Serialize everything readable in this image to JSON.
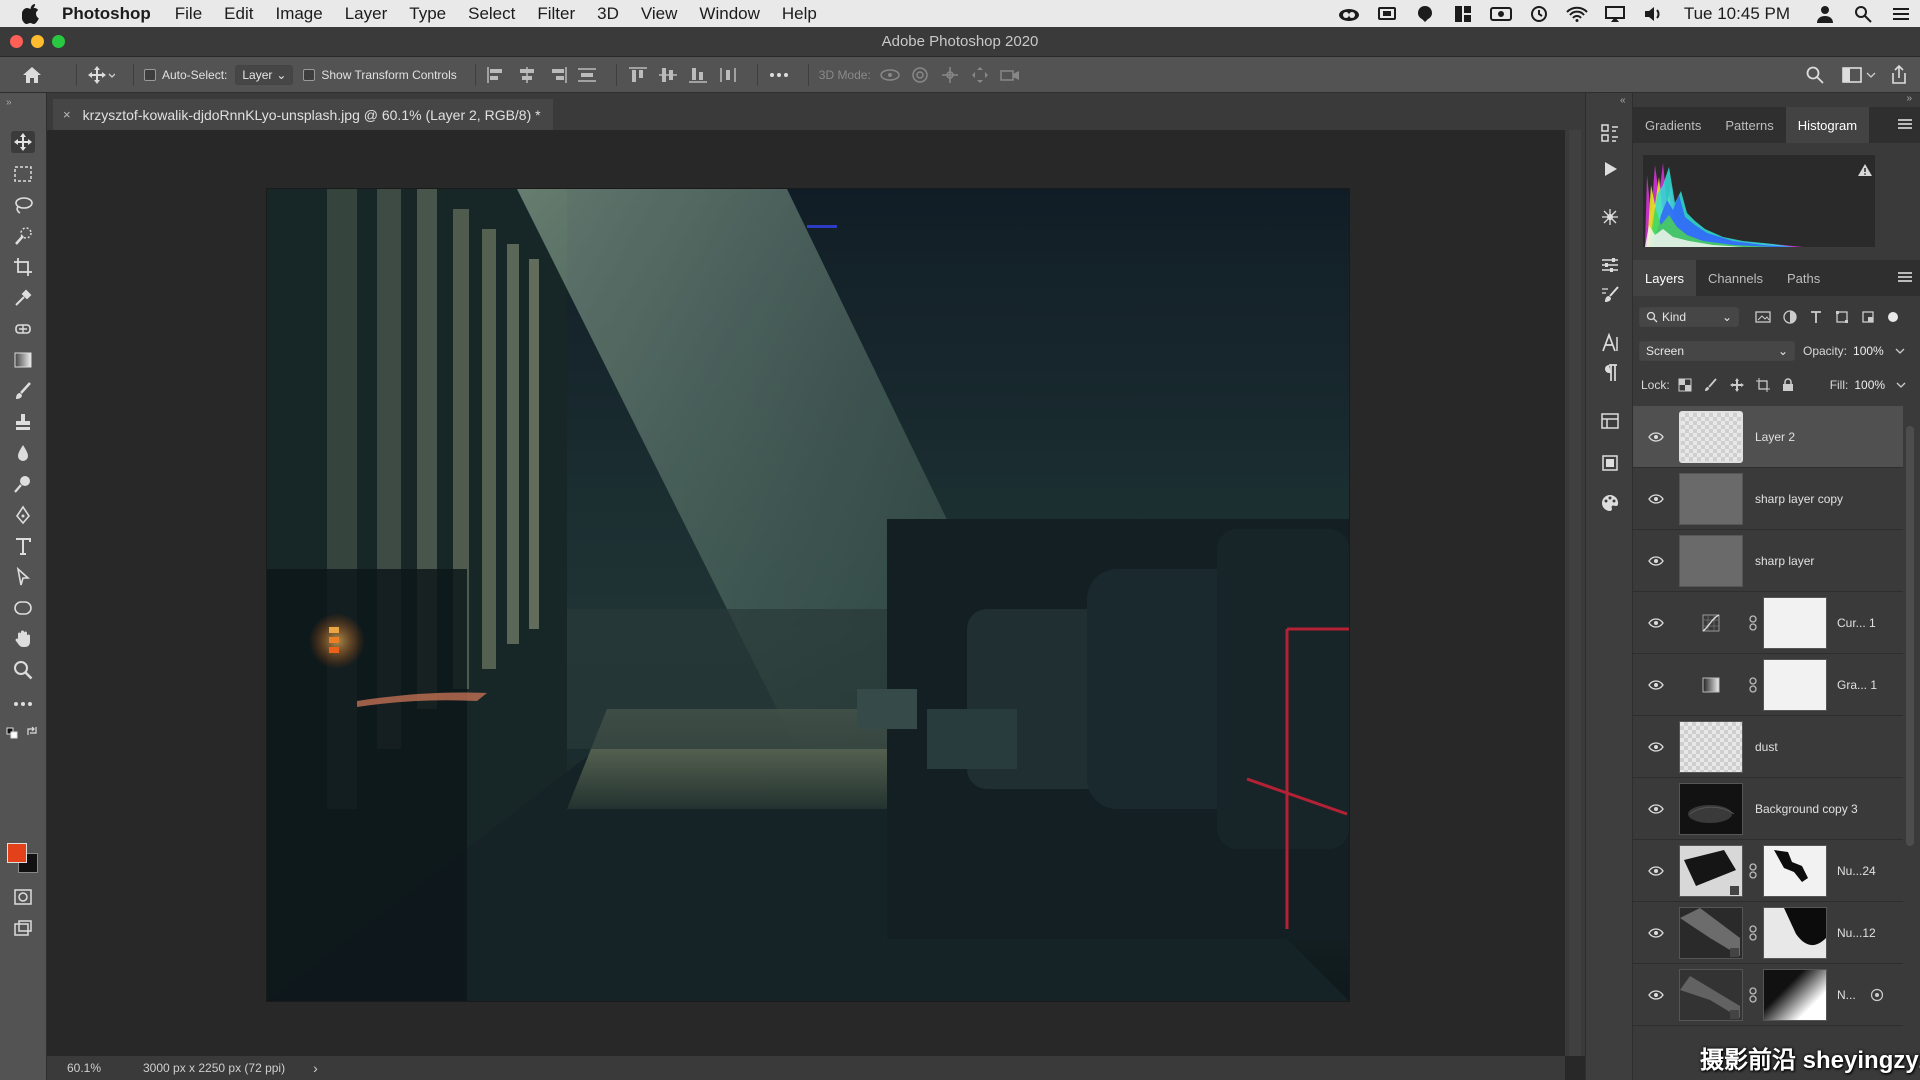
{
  "menubar": {
    "app_name": "Photoshop",
    "items": [
      "File",
      "Edit",
      "Image",
      "Layer",
      "Type",
      "Select",
      "Filter",
      "3D",
      "View",
      "Window",
      "Help"
    ],
    "clock": "Tue 10:45 PM"
  },
  "window": {
    "title": "Adobe Photoshop 2020"
  },
  "options_bar": {
    "auto_select_label": "Auto-Select:",
    "auto_select_target": "Layer",
    "show_transform_label": "Show Transform Controls",
    "mode_3d_label": "3D Mode:"
  },
  "document": {
    "tab_title": "krzysztof-kowalik-djdoRnnKLyo-unsplash.jpg @ 60.1% (Layer 2, RGB/8) *",
    "close_glyph": "×"
  },
  "status": {
    "zoom": "60.1%",
    "doc_info": "3000 px x 2250 px (72 ppi)",
    "arrow": "›"
  },
  "colors": {
    "foreground": "#e2411a",
    "background": "#111111"
  },
  "top_panel": {
    "tabs": [
      "Gradients",
      "Patterns",
      "Histogram"
    ],
    "active": "Histogram"
  },
  "layers_panel": {
    "tabs": [
      "Layers",
      "Channels",
      "Paths"
    ],
    "active": "Layers",
    "filter_label": "Kind",
    "blend_mode": "Screen",
    "opacity_label": "Opacity:",
    "opacity_value": "100%",
    "lock_label": "Lock:",
    "fill_label": "Fill:",
    "fill_value": "100%",
    "layers": [
      {
        "name": "Layer 2",
        "thumb": "transparent"
      },
      {
        "name": "sharp layer copy",
        "thumb": "gray"
      },
      {
        "name": "sharp layer",
        "thumb": "gray"
      },
      {
        "name": "Cur... 1",
        "thumb": "curves"
      },
      {
        "name": "Gra... 1",
        "thumb": "gradient-map"
      },
      {
        "name": "dust",
        "thumb": "transparent"
      },
      {
        "name": "Background copy 3",
        "thumb": "dark-photo"
      },
      {
        "name": "Nu...24",
        "thumb": "masked-photo"
      },
      {
        "name": "Nu...12",
        "thumb": "masked-photo"
      },
      {
        "name": "N...",
        "thumb": "masked-photo"
      }
    ]
  },
  "watermark": "摄影前沿 sheyingzyz.com"
}
